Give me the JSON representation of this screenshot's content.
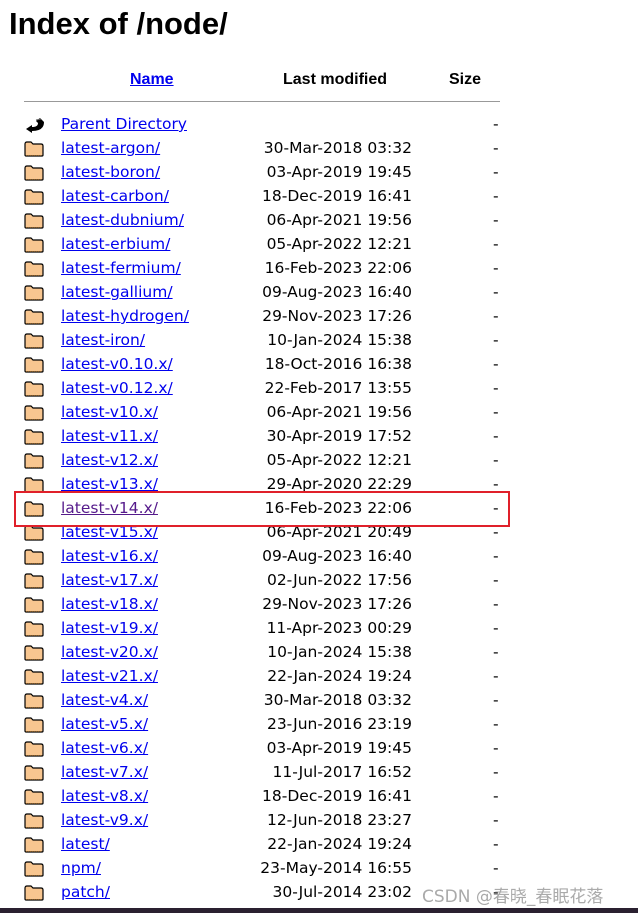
{
  "title": "Index of /node/",
  "columns": {
    "name": "Name",
    "modified": "Last modified",
    "size": "Size"
  },
  "colors": {
    "link": "#0000ee",
    "visited": "#551a8b",
    "highlight": "#e0202a"
  },
  "rows": [
    {
      "icon": "back-icon",
      "name": "Parent Directory",
      "date": "",
      "size": "-"
    },
    {
      "icon": "folder-icon",
      "name": "latest-argon/",
      "date": "30-Mar-2018 03:32",
      "size": "-"
    },
    {
      "icon": "folder-icon",
      "name": "latest-boron/",
      "date": "03-Apr-2019 19:45",
      "size": "-"
    },
    {
      "icon": "folder-icon",
      "name": "latest-carbon/",
      "date": "18-Dec-2019 16:41",
      "size": "-"
    },
    {
      "icon": "folder-icon",
      "name": "latest-dubnium/",
      "date": "06-Apr-2021 19:56",
      "size": "-"
    },
    {
      "icon": "folder-icon",
      "name": "latest-erbium/",
      "date": "05-Apr-2022 12:21",
      "size": "-"
    },
    {
      "icon": "folder-icon",
      "name": "latest-fermium/",
      "date": "16-Feb-2023 22:06",
      "size": "-"
    },
    {
      "icon": "folder-icon",
      "name": "latest-gallium/",
      "date": "09-Aug-2023 16:40",
      "size": "-"
    },
    {
      "icon": "folder-icon",
      "name": "latest-hydrogen/",
      "date": "29-Nov-2023 17:26",
      "size": "-"
    },
    {
      "icon": "folder-icon",
      "name": "latest-iron/",
      "date": "10-Jan-2024 15:38",
      "size": "-"
    },
    {
      "icon": "folder-icon",
      "name": "latest-v0.10.x/",
      "date": "18-Oct-2016 16:38",
      "size": "-"
    },
    {
      "icon": "folder-icon",
      "name": "latest-v0.12.x/",
      "date": "22-Feb-2017 13:55",
      "size": "-"
    },
    {
      "icon": "folder-icon",
      "name": "latest-v10.x/",
      "date": "06-Apr-2021 19:56",
      "size": "-"
    },
    {
      "icon": "folder-icon",
      "name": "latest-v11.x/",
      "date": "30-Apr-2019 17:52",
      "size": "-"
    },
    {
      "icon": "folder-icon",
      "name": "latest-v12.x/",
      "date": "05-Apr-2022 12:21",
      "size": "-"
    },
    {
      "icon": "folder-icon",
      "name": "latest-v13.x/",
      "date": "29-Apr-2020 22:29",
      "size": "-"
    },
    {
      "icon": "folder-icon",
      "name": "latest-v14.x/",
      "date": "16-Feb-2023 22:06",
      "size": "-",
      "visited": true,
      "highlighted": true
    },
    {
      "icon": "folder-icon",
      "name": "latest-v15.x/",
      "date": "06-Apr-2021 20:49",
      "size": "-"
    },
    {
      "icon": "folder-icon",
      "name": "latest-v16.x/",
      "date": "09-Aug-2023 16:40",
      "size": "-"
    },
    {
      "icon": "folder-icon",
      "name": "latest-v17.x/",
      "date": "02-Jun-2022 17:56",
      "size": "-"
    },
    {
      "icon": "folder-icon",
      "name": "latest-v18.x/",
      "date": "29-Nov-2023 17:26",
      "size": "-"
    },
    {
      "icon": "folder-icon",
      "name": "latest-v19.x/",
      "date": "11-Apr-2023 00:29",
      "size": "-"
    },
    {
      "icon": "folder-icon",
      "name": "latest-v20.x/",
      "date": "10-Jan-2024 15:38",
      "size": "-"
    },
    {
      "icon": "folder-icon",
      "name": "latest-v21.x/",
      "date": "22-Jan-2024 19:24",
      "size": "-"
    },
    {
      "icon": "folder-icon",
      "name": "latest-v4.x/",
      "date": "30-Mar-2018 03:32",
      "size": "-"
    },
    {
      "icon": "folder-icon",
      "name": "latest-v5.x/",
      "date": "23-Jun-2016 23:19",
      "size": "-"
    },
    {
      "icon": "folder-icon",
      "name": "latest-v6.x/",
      "date": "03-Apr-2019 19:45",
      "size": "-"
    },
    {
      "icon": "folder-icon",
      "name": "latest-v7.x/",
      "date": "11-Jul-2017 16:52",
      "size": "-"
    },
    {
      "icon": "folder-icon",
      "name": "latest-v8.x/",
      "date": "18-Dec-2019 16:41",
      "size": "-"
    },
    {
      "icon": "folder-icon",
      "name": "latest-v9.x/",
      "date": "12-Jun-2018 23:27",
      "size": "-"
    },
    {
      "icon": "folder-icon",
      "name": "latest/",
      "date": "22-Jan-2024 19:24",
      "size": "-"
    },
    {
      "icon": "folder-icon",
      "name": "npm/",
      "date": "23-May-2014 16:55",
      "size": "-"
    },
    {
      "icon": "folder-icon",
      "name": "patch/",
      "date": "30-Jul-2014 23:02",
      "size": "-"
    }
  ],
  "watermark": "CSDN @春晓_春眠花落"
}
